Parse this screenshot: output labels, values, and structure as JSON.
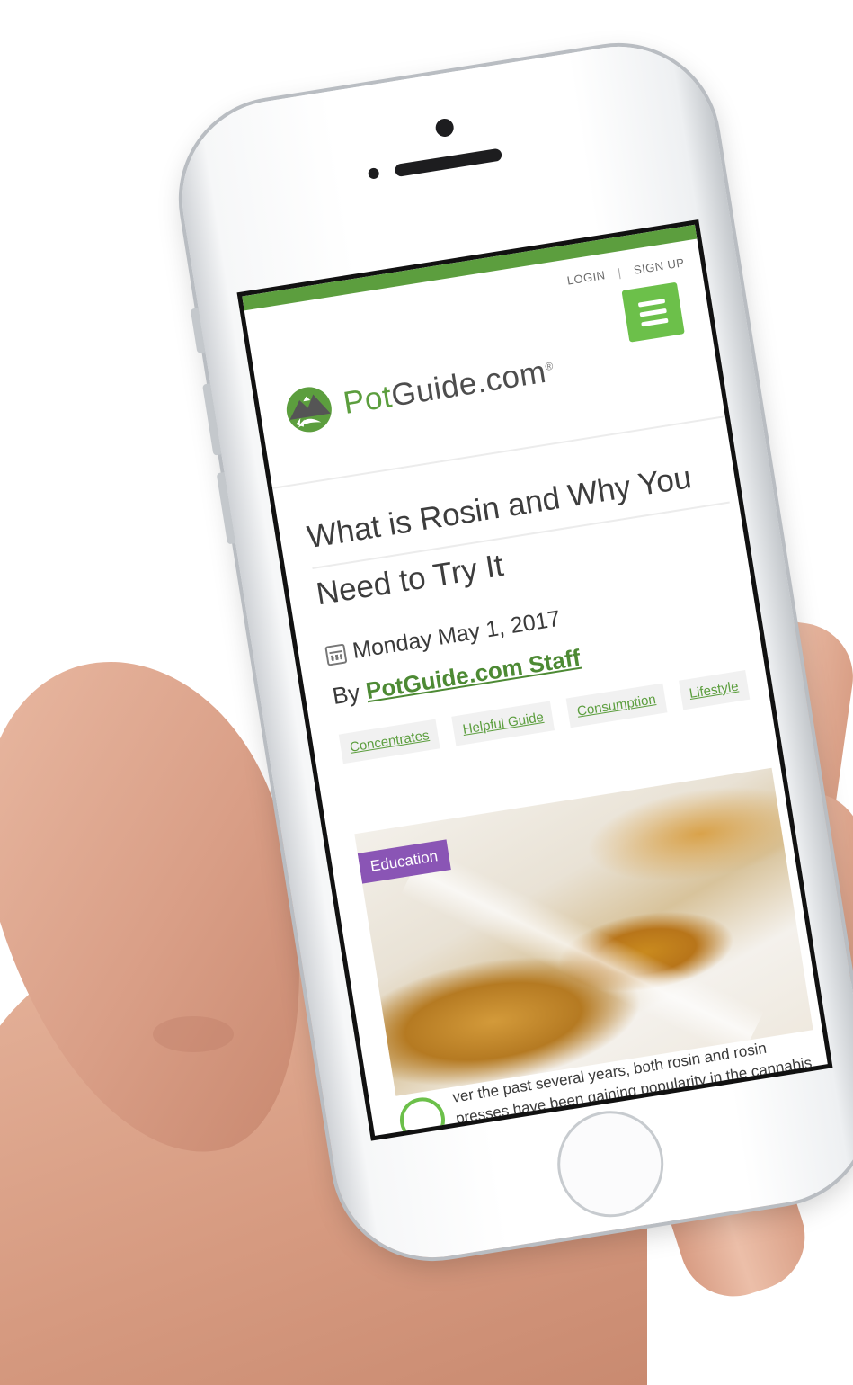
{
  "site": {
    "login_label": "LOGIN",
    "separator": "|",
    "signup_label": "SIGN UP",
    "logo_prefix": "Pot",
    "logo_suffix": "Guide.com",
    "logo_mark": "®"
  },
  "article": {
    "title": "What is Rosin and Why You Need to Try It",
    "date": "Monday May 1, 2017",
    "byline_prefix": "By",
    "author": "PotGuide.com Staff",
    "tags": [
      "Concentrates",
      "Helpful Guide",
      "Consumption",
      "Lifestyle"
    ],
    "category_badge": "Education",
    "dropcap": "O",
    "excerpt": "ver the past several years, both rosin and rosin presses have been gaining popularity in the cannabis industry, and for good reason. Don't"
  },
  "icons": {
    "menu": "hamburger-menu-icon",
    "calendar": "calendar-icon",
    "logo": "mountain-leaf-logo"
  },
  "colors": {
    "brand_green": "#5c9e3e",
    "menu_green": "#6cc04a",
    "badge_purple": "#8a55b5"
  }
}
